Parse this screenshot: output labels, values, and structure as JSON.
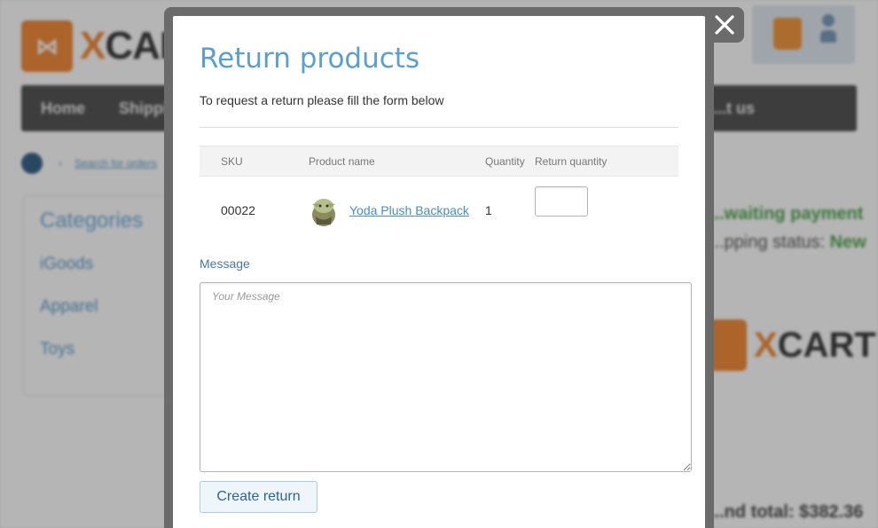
{
  "background": {
    "logo_text_x": "X",
    "logo_text": "CART",
    "nav_items": [
      "Home",
      "Shipping",
      "...t us"
    ],
    "breadcrumb_link": "Search for orders",
    "categories_title": "Categories",
    "categories": [
      "iGoods",
      "Apparel",
      "Toys"
    ],
    "payment_status": "...waiting payment",
    "shipping_status_label": "...pping status:",
    "shipping_status_value": "New",
    "grand_total": "...nd total: $382.36"
  },
  "modal": {
    "title": "Return products",
    "intro": "To request a return please fill the form below",
    "table": {
      "headers": {
        "sku": "SKU",
        "name": "Product name",
        "quantity": "Quantity",
        "return_quantity": "Return quantity"
      },
      "rows": [
        {
          "sku": "00022",
          "name": "Yoda Plush Backpack",
          "quantity": "1",
          "return_quantity": ""
        }
      ]
    },
    "message_label": "Message",
    "message_placeholder": "Your Message",
    "submit_label": "Create return"
  },
  "colors": {
    "title_blue": "#5b9fd0",
    "link_blue": "#4a8cc4",
    "modal_frame": "#6b6b6b",
    "xcart_orange": "#f07c21"
  },
  "icons": {
    "close": "close-icon",
    "product_thumb": "product-thumbnail"
  }
}
